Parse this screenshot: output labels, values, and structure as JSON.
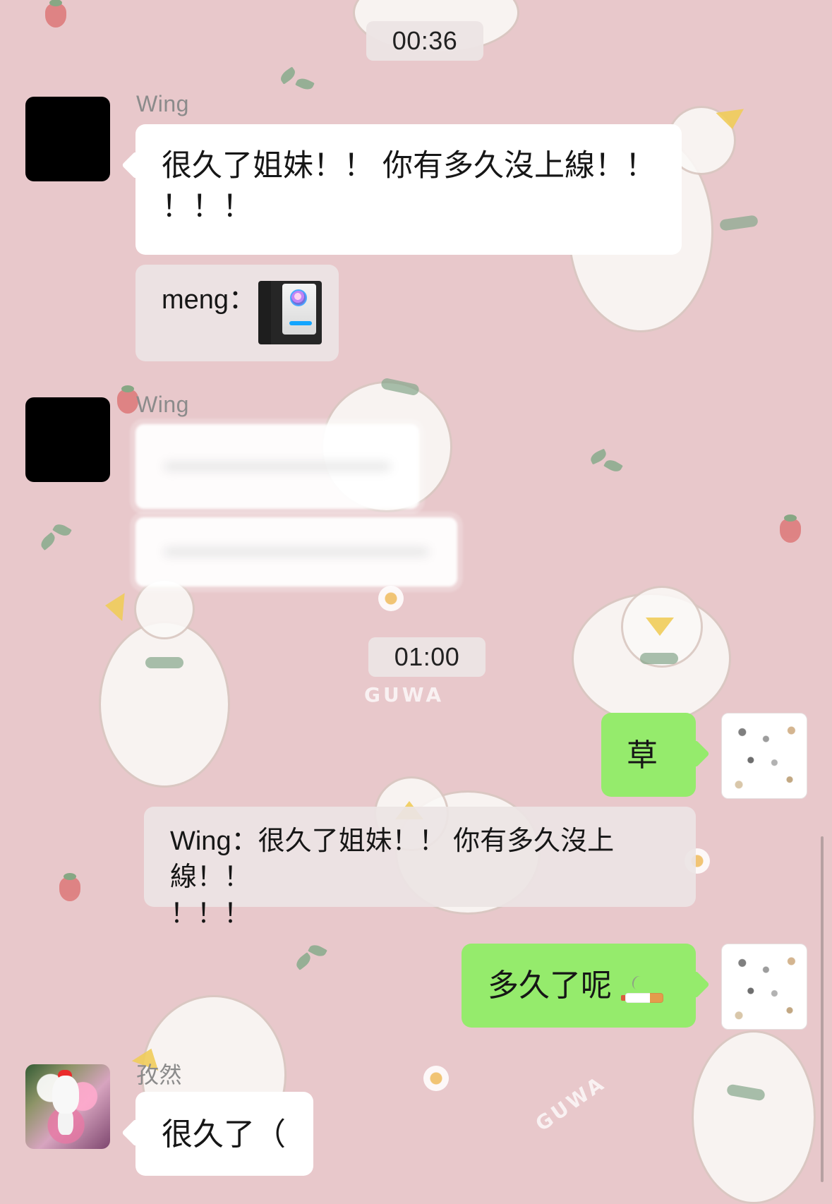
{
  "timestamps": {
    "first": "00:36",
    "second": "01:00"
  },
  "messages": {
    "wing_1_name": "Wing",
    "wing_1_text": "很久了姐妹！！ 你有多久沒上線！！\n！！！",
    "wing_1_quote_prefix": "meng：",
    "wing_2_name": "Wing",
    "me_1_text": "草",
    "quote_text": "Wing：很久了姐妹！！ 你有多久沒上線！！\n！！！",
    "me_2_text": "多久了呢",
    "other_name": "孜然",
    "other_text": "很久了（"
  },
  "icons": {
    "cigarette": "cigarette-icon"
  },
  "colors": {
    "background": "#e8c8cb",
    "green_bubble": "#95eb6c",
    "white_bubble": "#ffffff"
  }
}
